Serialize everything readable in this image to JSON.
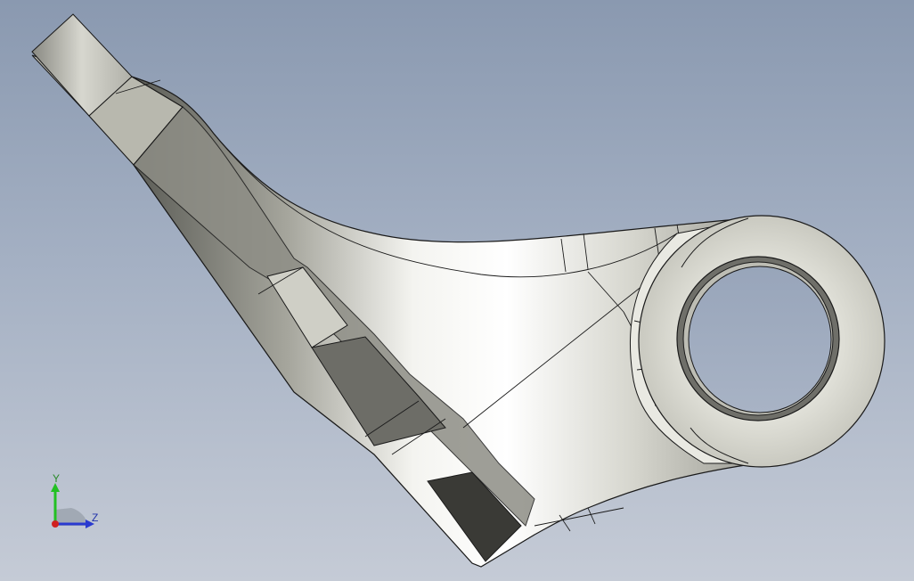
{
  "viewport": {
    "background_top": "#8a99b0",
    "background_bottom": "#c5cbd6",
    "model_color": "#cfcfc8",
    "edge_color": "#1a1a1a"
  },
  "triad": {
    "y_label": "Y",
    "z_label": "Z",
    "y_color": "#22c022",
    "z_color": "#2a3ad0",
    "x_color": "#d02020"
  }
}
